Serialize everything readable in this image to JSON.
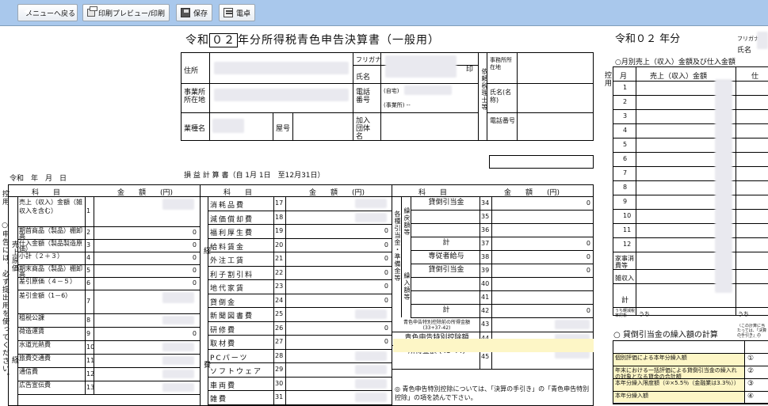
{
  "toolbar": {
    "back_label": "メニューへ戻る",
    "print_label": "印刷プレビュー/印刷",
    "save_label": "保存",
    "calc_label": "電卓"
  },
  "form": {
    "title": "令和",
    "year": "０２",
    "title_rest": "年分所得税青色申告決算書（一般用）",
    "address_label": "住所",
    "furigana_label": "フリガナ",
    "name_label": "氏名",
    "seal_label": "印",
    "office_addr_label": "事業所所在地",
    "phone_label": "電話番号",
    "home_label": "(自宅)",
    "office_label": "(事業所) --",
    "business_label": "業種名",
    "shop_label": "屋号",
    "assoc_label": "加入団体名",
    "agent_label": "依頼税理士等",
    "agent_addr_label": "事務所所在地",
    "agent_name_label": "氏名(名称)",
    "agent_phone_label": "電話番号"
  },
  "pl": {
    "date_label": "令和　年　月　日",
    "title": "損 益 計 算 書（自 1月 1日　至12月31日）",
    "col_subject": "科　　目",
    "col_amount": "金　　額　　(円)",
    "side_label": "控用",
    "left_note": "○申告には、必ず提出用を使ってください。",
    "rows_left": [
      {
        "no": "1",
        "label": "売上（収入）金額（雑収入を含む）",
        "value": ""
      },
      {
        "no": "2",
        "label": "期首商品（製品）棚卸高",
        "value": "0"
      },
      {
        "no": "3",
        "label": "仕入金額（製品製造原価）",
        "value": "0"
      },
      {
        "no": "4",
        "label": "小計（２＋３）",
        "value": "0"
      },
      {
        "no": "5",
        "label": "期末商品（製品）棚卸高",
        "value": "0"
      },
      {
        "no": "6",
        "label": "差引原価（４－５）",
        "value": "0"
      },
      {
        "no": "7",
        "label": "差引金額（1－6）",
        "value": ""
      },
      {
        "no": "8",
        "label": "租税公課",
        "value": ""
      },
      {
        "no": "9",
        "label": "荷造運賃",
        "value": "0"
      },
      {
        "no": "10",
        "label": "水道光熱費",
        "value": ""
      },
      {
        "no": "11",
        "label": "旅費交通費",
        "value": ""
      },
      {
        "no": "12",
        "label": "通信費",
        "value": ""
      },
      {
        "no": "13",
        "label": "広告宣伝費",
        "value": ""
      }
    ],
    "cost_label": "売上原価",
    "expense_label": "経",
    "rows_mid": [
      {
        "no": "17",
        "label": "消耗品費",
        "value": ""
      },
      {
        "no": "18",
        "label": "減価償却費",
        "value": ""
      },
      {
        "no": "19",
        "label": "福利厚生費",
        "value": "0"
      },
      {
        "no": "20",
        "label": "給料賃金",
        "value": "0"
      },
      {
        "no": "21",
        "label": "外注工賃",
        "value": "0"
      },
      {
        "no": "22",
        "label": "利子割引料",
        "value": "0"
      },
      {
        "no": "23",
        "label": "地代家賃",
        "value": "0"
      },
      {
        "no": "24",
        "label": "貸倒金",
        "value": "0"
      },
      {
        "no": "25",
        "label": "新聞図書費",
        "value": ""
      },
      {
        "no": "26",
        "label": "研修費",
        "value": "0"
      },
      {
        "no": "27",
        "label": "取材費",
        "value": "0"
      },
      {
        "no": "28",
        "label": "PCパーツ",
        "value": ""
      },
      {
        "no": "29",
        "label": "ソフトウェア",
        "value": ""
      },
      {
        "no": "30",
        "label": "車両費",
        "value": ""
      },
      {
        "no": "31",
        "label": "雑費",
        "value": ""
      }
    ],
    "mid_expense_label": "経",
    "mid_expense_label2": "費",
    "rows_right": [
      {
        "no": "34",
        "label": "貸倒引当金",
        "value": "0"
      },
      {
        "no": "35",
        "label": "",
        "value": ""
      },
      {
        "no": "36",
        "label": "",
        "value": ""
      },
      {
        "no": "37",
        "label": "計",
        "value": "0"
      },
      {
        "no": "38",
        "label": "専従者給与",
        "value": "0"
      },
      {
        "no": "39",
        "label": "貸倒引当金",
        "value": "0"
      },
      {
        "no": "40",
        "label": "",
        "value": ""
      },
      {
        "no": "41",
        "label": "",
        "value": ""
      },
      {
        "no": "42",
        "label": "計",
        "value": "0"
      },
      {
        "no": "43",
        "label": "青色申告特別控除前の所得金額 (33+37-42)",
        "value": ""
      },
      {
        "no": "44",
        "label": "青色申告特別控除額",
        "value": ""
      },
      {
        "no": "45",
        "label": "所得金額 (43-44)",
        "value": ""
      }
    ],
    "right_side_a": "各種引当金・準備金等",
    "right_side_b": "繰戻額等",
    "right_side_c": "繰入額等",
    "footnote": "◎ 青色申告特別控除については、「決算の手引き」の「青色申告特別控除」の項を読んで下さい。"
  },
  "sales": {
    "title_prefix": "令和０２ 年分",
    "furigana": "フリガナ",
    "name": "氏名",
    "section_title": "○月別売上（収入）金額及び仕入金額",
    "side_label": "控用",
    "col_month": "月",
    "col_sales": "売上（収入）金額",
    "col_purchase": "仕",
    "months": [
      "1",
      "2",
      "3",
      "4",
      "5",
      "6",
      "7",
      "8",
      "9",
      "10",
      "11",
      "12"
    ],
    "home_use": "家事消費等",
    "misc_income": "雑収入",
    "total": "計",
    "small_label": "うち軽減税率対象",
    "uchi": "うち",
    "allowance_title": "○ 貸倒引当金の繰入額の計算",
    "allowance_note": "（この計算に当たっては、「決算の手引き」の「貸倒引当金」の項を読んでください。）",
    "allowance_rows": [
      {
        "mark": "①",
        "label": "個別評価による本年分繰入額"
      },
      {
        "mark": "②",
        "label": "年末における一括評価による貸倒引当金の繰入れの対象となる貸金の合計額"
      },
      {
        "mark": "③",
        "label": "本年分繰入限度額（②×5.5％（金融業は3.3％））"
      },
      {
        "mark": "④",
        "label": "本年分繰入額"
      }
    ],
    "bulk_label": "一括評価による本年分繰入額"
  },
  "colors": {
    "toolbar": "#a9c8ec",
    "highlight": "#fdf6c6",
    "blur": "#e9e9ef"
  }
}
